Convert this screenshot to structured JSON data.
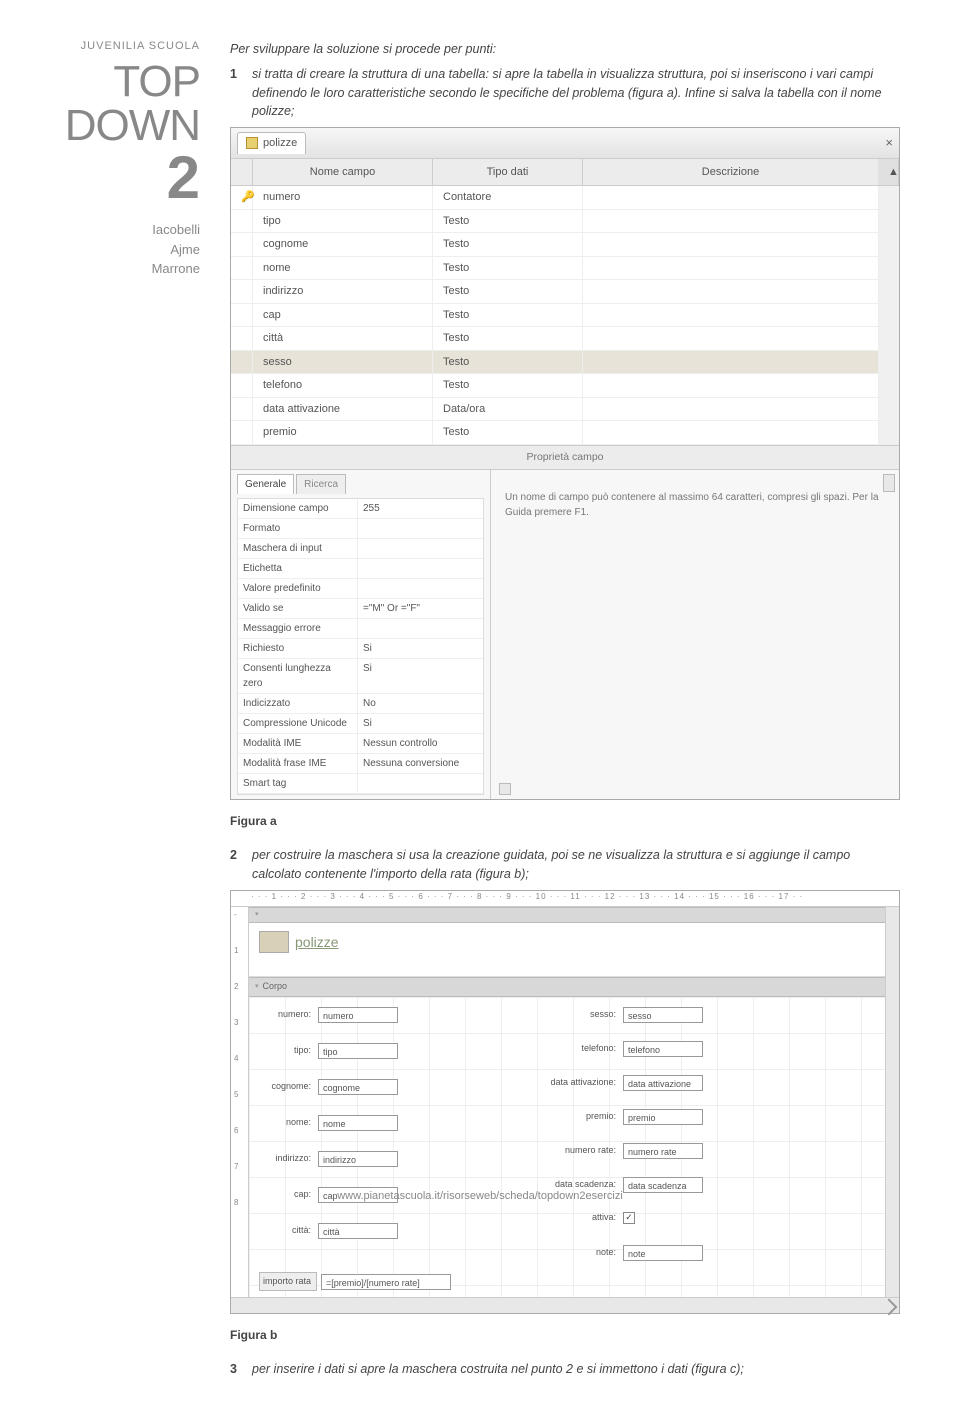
{
  "sidebar": {
    "brand": "JUVENILIA SCUOLA",
    "line1": "TOP",
    "line2": "DOWN",
    "num": "2",
    "authors": [
      "Iacobelli",
      "Ajme",
      "Marrone"
    ]
  },
  "intro": "Per sviluppare la soluzione si procede per punti:",
  "steps": {
    "1": "si tratta di creare la struttura di una tabella: si apre la tabella in visualizza struttura, poi si inseriscono i vari campi definendo le loro caratteristiche secondo le specifiche del problema (figura a). Infine si salva la tabella con il nome polizze;",
    "2": "per costruire la maschera si usa la creazione guidata, poi se ne visualizza la struttura e si aggiunge il campo calcolato contenente l'importo della rata (figura b);",
    "3": "per inserire i dati si apre la maschera costruita nel punto 2 e si immettono i dati (figura c);"
  },
  "fig_a": {
    "tab": "polizze",
    "columns": {
      "c2": "Nome campo",
      "c3": "Tipo dati",
      "c4": "Descrizione"
    },
    "rows": [
      {
        "key": true,
        "name": "numero",
        "type": "Contatore"
      },
      {
        "name": "tipo",
        "type": "Testo"
      },
      {
        "name": "cognome",
        "type": "Testo"
      },
      {
        "name": "nome",
        "type": "Testo"
      },
      {
        "name": "indirizzo",
        "type": "Testo"
      },
      {
        "name": "cap",
        "type": "Testo"
      },
      {
        "name": "città",
        "type": "Testo"
      },
      {
        "name": "sesso",
        "type": "Testo",
        "sel": true
      },
      {
        "name": "telefono",
        "type": "Testo"
      },
      {
        "name": "data attivazione",
        "type": "Data/ora"
      },
      {
        "name": "premio",
        "type": "Testo"
      }
    ],
    "prop_title": "Proprietà campo",
    "prop_tabs": {
      "a": "Generale",
      "b": "Ricerca"
    },
    "props": [
      {
        "k": "Dimensione campo",
        "v": "255"
      },
      {
        "k": "Formato",
        "v": ""
      },
      {
        "k": "Maschera di input",
        "v": ""
      },
      {
        "k": "Etichetta",
        "v": ""
      },
      {
        "k": "Valore predefinito",
        "v": ""
      },
      {
        "k": "Valido se",
        "v": "=\"M\" Or =\"F\""
      },
      {
        "k": "Messaggio errore",
        "v": ""
      },
      {
        "k": "Richiesto",
        "v": "Si"
      },
      {
        "k": "Consenti lunghezza zero",
        "v": "Si"
      },
      {
        "k": "Indicizzato",
        "v": "No"
      },
      {
        "k": "Compressione Unicode",
        "v": "Si"
      },
      {
        "k": "Modalità IME",
        "v": "Nessun controllo"
      },
      {
        "k": "Modalità frase IME",
        "v": "Nessuna conversione"
      },
      {
        "k": "Smart tag",
        "v": ""
      }
    ],
    "hint": "Un nome di campo può contenere al massimo 64 caratteri, compresi gli spazi. Per la Guida premere F1."
  },
  "caption_a": "Figura a",
  "fig_b": {
    "ruler": "· · · 1 · · · 2 · · · 3 · · · 4 · · · 5 · · · 6 · · · 7 · · · 8 · · · 9 · · · 10 · · · 11 · · · 12 · · · 13 · · · 14 · · · 15 · · · 16 · · · 17 · ·",
    "title": "polizze",
    "band_body": "Corpo",
    "fields_left": [
      {
        "lbl": "numero:",
        "val": "numero"
      },
      {
        "lbl": "tipo:",
        "val": "tipo"
      },
      {
        "lbl": "cognome:",
        "val": "cognome"
      },
      {
        "lbl": "nome:",
        "val": "nome"
      },
      {
        "lbl": "indirizzo:",
        "val": "indirizzo"
      },
      {
        "lbl": "cap:",
        "val": "cap"
      },
      {
        "lbl": "città:",
        "val": "città"
      }
    ],
    "fields_right": [
      {
        "lbl": "sesso:",
        "val": "sesso"
      },
      {
        "lbl": "telefono:",
        "val": "telefono"
      },
      {
        "lbl": "data attivazione:",
        "val": "data attivazione"
      },
      {
        "lbl": "premio:",
        "val": "premio"
      },
      {
        "lbl": "numero rate:",
        "val": "numero rate"
      },
      {
        "lbl": "data scadenza:",
        "val": "data scadenza"
      },
      {
        "lbl": "attiva:",
        "chk": true
      },
      {
        "lbl": "note:",
        "val": "note"
      }
    ],
    "calc": {
      "lbl": "importo rata",
      "val": "=[premio]/[numero rate]"
    }
  },
  "caption_b": "Figura b",
  "footer": "www.pianetascuola.it/risorseweb/scheda/topdown2esercizi"
}
